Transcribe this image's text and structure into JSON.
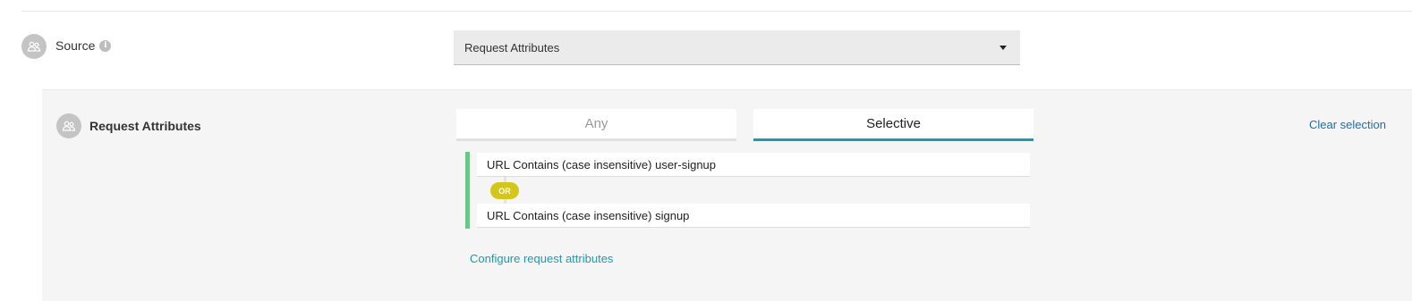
{
  "source": {
    "label": "Source",
    "select_value": "Request Attributes"
  },
  "request_attributes": {
    "label": "Request Attributes",
    "tabs": [
      {
        "label": "Any",
        "active": false
      },
      {
        "label": "Selective",
        "active": true
      }
    ],
    "clear_label": "Clear selection",
    "rules": [
      "URL Contains (case insensitive) user-signup",
      "URL Contains (case insensitive) signup"
    ],
    "operator": "OR",
    "configure_label": "Configure request attributes"
  },
  "colors": {
    "accent_teal": "#1a9cb0",
    "link_blue": "#1b6fae",
    "rule_bar_green": "#6cc485",
    "or_badge_yellow": "#d4c61a",
    "panel_bg": "#f4f5f4"
  },
  "icons": [
    "user-group-icon",
    "info-icon",
    "chevron-down-icon"
  ]
}
